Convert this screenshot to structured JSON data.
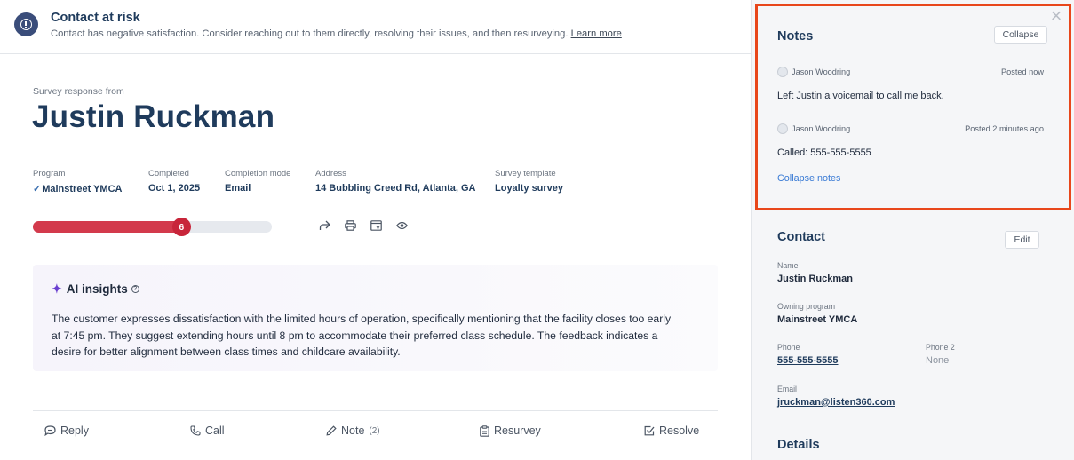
{
  "alert": {
    "title": "Contact at risk",
    "text": "Contact has negative satisfaction. Consider reaching out to them directly, resolving their issues, and then resurveying.",
    "link": "Learn more"
  },
  "survey": {
    "from_label": "Survey response from",
    "name": "Justin Ruckman",
    "meta": [
      {
        "label": "Program",
        "value": "Mainstreet YMCA"
      },
      {
        "label": "Completed",
        "value": "Oct 1, 2025"
      },
      {
        "label": "Completion mode",
        "value": "Email"
      },
      {
        "label": "Address",
        "value": "14 Bubbling Creed Rd, Atlanta, GA"
      },
      {
        "label": "Survey template",
        "value": "Loyalty survey"
      }
    ],
    "score": "6",
    "score_fraction": 0.62
  },
  "ai": {
    "title": "AI insights",
    "help": "?",
    "text": "The customer expresses dissatisfaction with the limited hours of operation, specifically mentioning that the facility closes too early at 7:45 pm. They suggest extending hours until 8 pm to accommodate their preferred class schedule. The feedback indicates a desire for better alignment between class times and childcare availability."
  },
  "actions": {
    "reply": "Reply",
    "call": "Call",
    "note": "Note",
    "note_count": "(2)",
    "resurvey": "Resurvey",
    "resolve": "Resolve"
  },
  "notes": {
    "title": "Notes",
    "collapse_btn": "Collapse",
    "items": [
      {
        "author": "Jason Woodring",
        "time": "Posted now",
        "text": "Left Justin a voicemail to call me back."
      },
      {
        "author": "Jason Woodring",
        "time": "Posted 2 minutes ago",
        "text": "Called: 555-555-5555"
      }
    ],
    "collapse_link": "Collapse notes"
  },
  "contact": {
    "title": "Contact",
    "edit_btn": "Edit",
    "name_label": "Name",
    "name": "Justin Ruckman",
    "program_label": "Owning program",
    "program": "Mainstreet YMCA",
    "phone_label": "Phone",
    "phone": "555-555-5555",
    "phone2_label": "Phone 2",
    "phone2": "None",
    "email_label": "Email",
    "email": "jruckman@listen360.com"
  },
  "details": {
    "title": "Details"
  },
  "colors": {
    "accent_red": "#d33a4c",
    "highlight": "#e8471b",
    "heading": "#1f3b5c"
  }
}
